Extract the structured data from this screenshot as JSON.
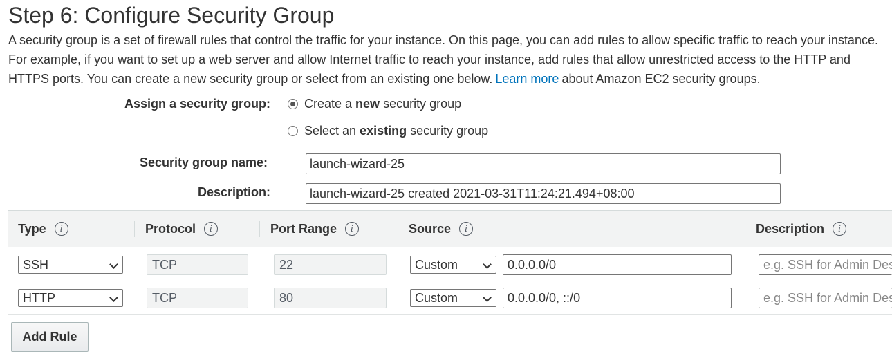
{
  "title": "Step 6: Configure Security Group",
  "intro": {
    "text_before": "A security group is a set of firewall rules that control the traffic for your instance. On this page, you can add rules to allow specific traffic to reach your instance. For example, if you want to set up a web server and allow Internet traffic to reach your instance, add rules that allow unrestricted access to the HTTP and HTTPS ports. You can create a new security group or select from an existing one below.",
    "link": "Learn more",
    "text_after": "about Amazon EC2 security groups."
  },
  "assign": {
    "label": "Assign a security group:",
    "options": [
      {
        "pre": "Create a ",
        "bold": "new",
        "post": " security group",
        "checked": true
      },
      {
        "pre": "Select an ",
        "bold": "existing",
        "post": " security group",
        "checked": false
      }
    ]
  },
  "sg_name": {
    "label": "Security group name:",
    "value": "launch-wizard-25"
  },
  "sg_desc": {
    "label": "Description:",
    "value": "launch-wizard-25 created 2021-03-31T11:24:21.494+08:00"
  },
  "table": {
    "headers": [
      "Type",
      "Protocol",
      "Port Range",
      "Source",
      "Description"
    ],
    "rows": [
      {
        "type": "SSH",
        "protocol": "TCP",
        "port": "22",
        "source_mode": "Custom",
        "source": "0.0.0.0/0",
        "desc_placeholder": "e.g. SSH for Admin Desktop"
      },
      {
        "type": "HTTP",
        "protocol": "TCP",
        "port": "80",
        "source_mode": "Custom",
        "source": "0.0.0.0/0, ::/0",
        "desc_placeholder": "e.g. SSH for Admin Desktop"
      }
    ]
  },
  "add_rule_label": "Add Rule",
  "info_icon_glyph": "i",
  "colors": {
    "link": "#0073bb",
    "header_bg": "#f2f3f3"
  }
}
